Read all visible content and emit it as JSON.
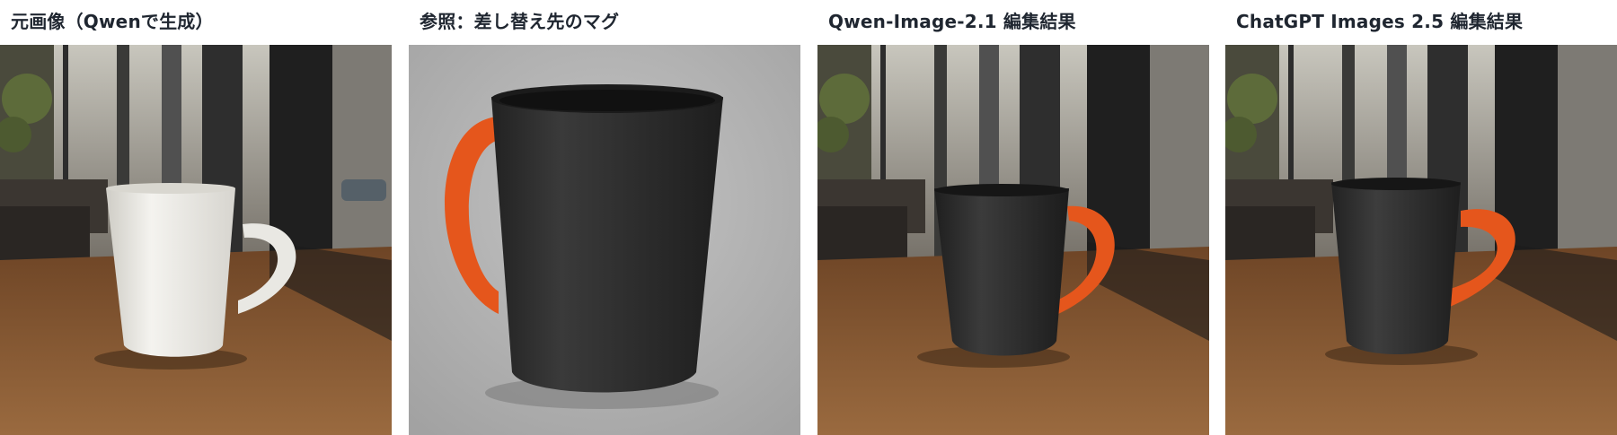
{
  "panels": [
    {
      "caption": "元画像（Qwenで生成）",
      "scene": "cafe-window",
      "mug": "white"
    },
    {
      "caption": "参照：差し替え先のマグ",
      "scene": "studio-gray",
      "mug": "black-orange-large"
    },
    {
      "caption": "Qwen-Image-2.1 編集結果",
      "scene": "cafe-window",
      "mug": "black-orange"
    },
    {
      "caption": "ChatGPT Images 2.5 編集結果",
      "scene": "cafe-window",
      "mug": "black-orange"
    }
  ],
  "colors": {
    "table_wood": "#8a5a33",
    "mug_white": "#ecebe6",
    "mug_black": "#2a2a2a",
    "handle_orange": "#e5561c",
    "studio_gray": "#b9b9b9"
  }
}
